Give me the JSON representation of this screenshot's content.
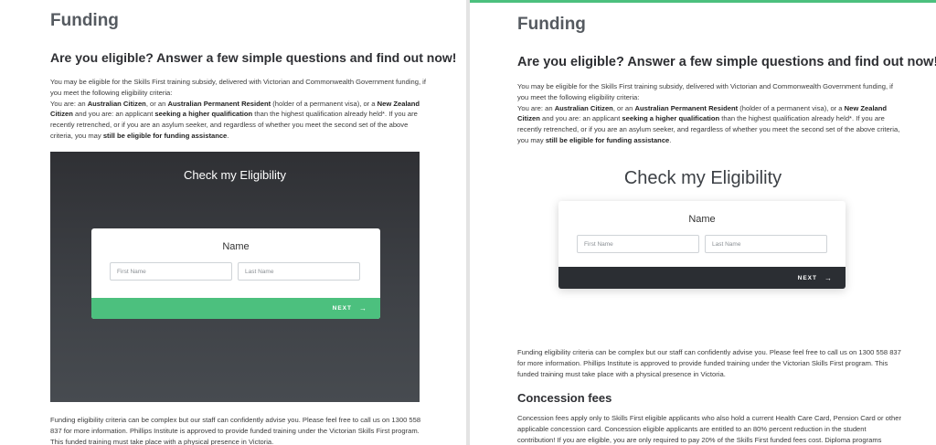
{
  "page": {
    "funding_heading": "Funding",
    "eligible_heading": "Are you eligible? Answer a few simple questions and find out now!",
    "intro": {
      "line1": "You may be eligible for the Skills First training subsidy, delivered with Victorian and Commonwealth Government funding, if you meet the following eligibility criteria:",
      "you_are": "You are: an ",
      "citizen": "Australian Citizen",
      "or_an": ", or an ",
      "resident": "Australian Permanent Resident",
      "visa": " (holder of a permanent visa), or a ",
      "nz": "New Zealand Citizen",
      "and_you": " and you are: an applicant ",
      "higher": "seeking a higher qualification",
      "than": " than the highest qualification already held*.  If you are recently retrenched, or if you are an asylum seeker, and regardless of whether you meet the second set of the above criteria, you may ",
      "still": "still be eligible for funding assistance",
      "end": "."
    },
    "check_title": "Check my Eligibility",
    "card": {
      "name_label": "Name",
      "first_placeholder": "First Name",
      "last_placeholder": "Last Name",
      "next_label": "NEXT",
      "next_arrow": "→"
    },
    "para2": "Funding eligibility criteria can be complex but our staff can confidently advise you. Please feel free to call us on 1300 558 837 for more information. Phillips Institute is approved to provide funded training under the Victorian Skills First program. This funded training must take place with a physical presence in Victoria.",
    "concession_heading": "Concession fees",
    "para3": "Concession fees apply only to Skills First eligible applicants who also hold a current Health Care Card, Pension Card or other applicable concession card.  Concession eligible applicants are entitled to an 80% percent reduction in the student contribution!  If you are eligible, you are only required to pay 20% of the Skills First funded fees cost.  Diploma programs"
  },
  "colors": {
    "accent_green": "#4cc07e",
    "dark_button": "#2b2e33",
    "hero_dark": "#3e4146"
  }
}
